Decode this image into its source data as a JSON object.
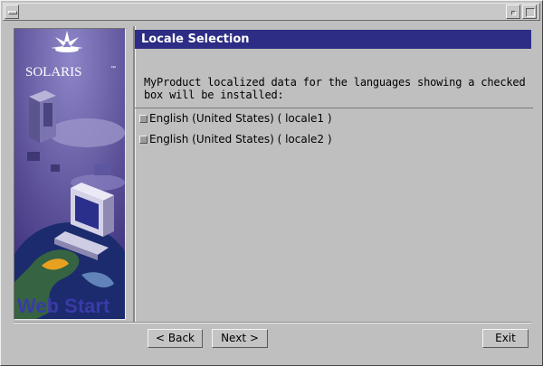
{
  "window": {
    "title": ""
  },
  "sidebar": {
    "brand": "SOLARIS",
    "brand_tm": "™",
    "product": "Web Start"
  },
  "main": {
    "section_title": "Locale Selection",
    "description": "MyProduct localized data for the languages showing a checked box will be installed:",
    "locales": [
      {
        "label": "English (United States) ( locale1 )",
        "checked": true
      },
      {
        "label": "English (United States) ( locale2 )",
        "checked": true
      }
    ]
  },
  "buttons": {
    "back": "< Back",
    "next": "Next >",
    "exit": "Exit"
  },
  "colors": {
    "header_bg": "#2d2d86",
    "panel_bg": "#4a3c86",
    "window_bg": "#bfbfbf"
  }
}
